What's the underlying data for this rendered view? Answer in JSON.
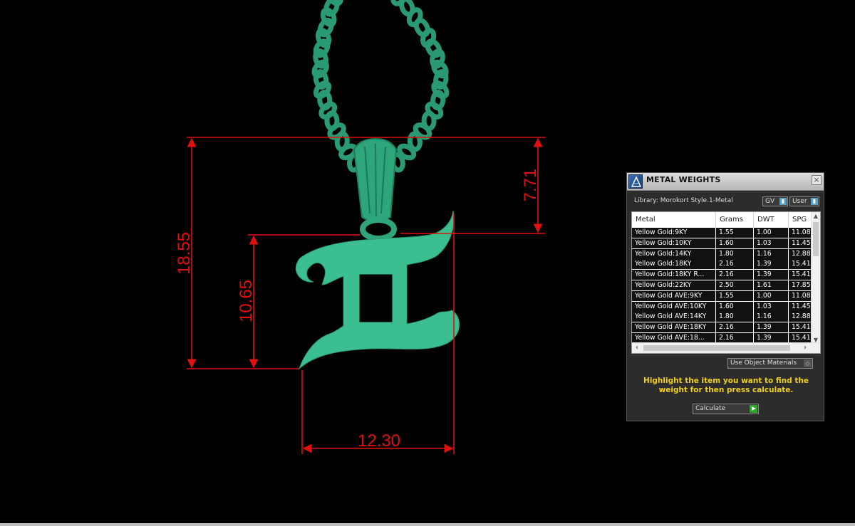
{
  "viewport": {
    "dimensions": [
      {
        "name": "height-overall",
        "value": "18.55"
      },
      {
        "name": "height-bail",
        "value": "7.71"
      },
      {
        "name": "height-symbol",
        "value": "10.65"
      },
      {
        "name": "width-symbol",
        "value": "12.30"
      }
    ],
    "colors": {
      "dimension": "#e01010",
      "model": "#2faa7e",
      "background": "#000000"
    }
  },
  "panel": {
    "title": "METAL WEIGHTS",
    "close_icon": "×",
    "library_label": "Library: Morokort Style.1-Metal",
    "gv_label": "GV",
    "user_label": "User",
    "table": {
      "headers": [
        "Metal",
        "Grams",
        "DWT",
        "SPG"
      ],
      "rows": [
        [
          "Yellow Gold:9KY",
          "1.55",
          "1.00",
          "11.08"
        ],
        [
          "Yellow Gold:10KY",
          "1.60",
          "1.03",
          "11.45"
        ],
        [
          "Yellow Gold:14KY",
          "1.80",
          "1.16",
          "12.88"
        ],
        [
          "Yellow Gold:18KY",
          "2.16",
          "1.39",
          "15.41"
        ],
        [
          "Yellow Gold:18KY R...",
          "2.16",
          "1.39",
          "15.41"
        ],
        [
          "Yellow Gold:22KY",
          "2.50",
          "1.61",
          "17.85"
        ],
        [
          "Yellow Gold AVE:9KY",
          "1.55",
          "1.00",
          "11.08"
        ],
        [
          "Yellow Gold AVE:10KY",
          "1.60",
          "1.03",
          "11.45"
        ],
        [
          "Yellow Gold AVE:14KY",
          "1.80",
          "1.16",
          "12.88"
        ],
        [
          "Yellow Gold AVE:18KY",
          "2.16",
          "1.39",
          "15.41"
        ],
        [
          "Yellow Gold AVE:18...",
          "2.16",
          "1.39",
          "15.41"
        ]
      ]
    },
    "use_object_materials": "Use Object Materials",
    "hint": "Highlight the item you want to find the weight for then press calculate.",
    "calculate_label": "Calculate"
  }
}
